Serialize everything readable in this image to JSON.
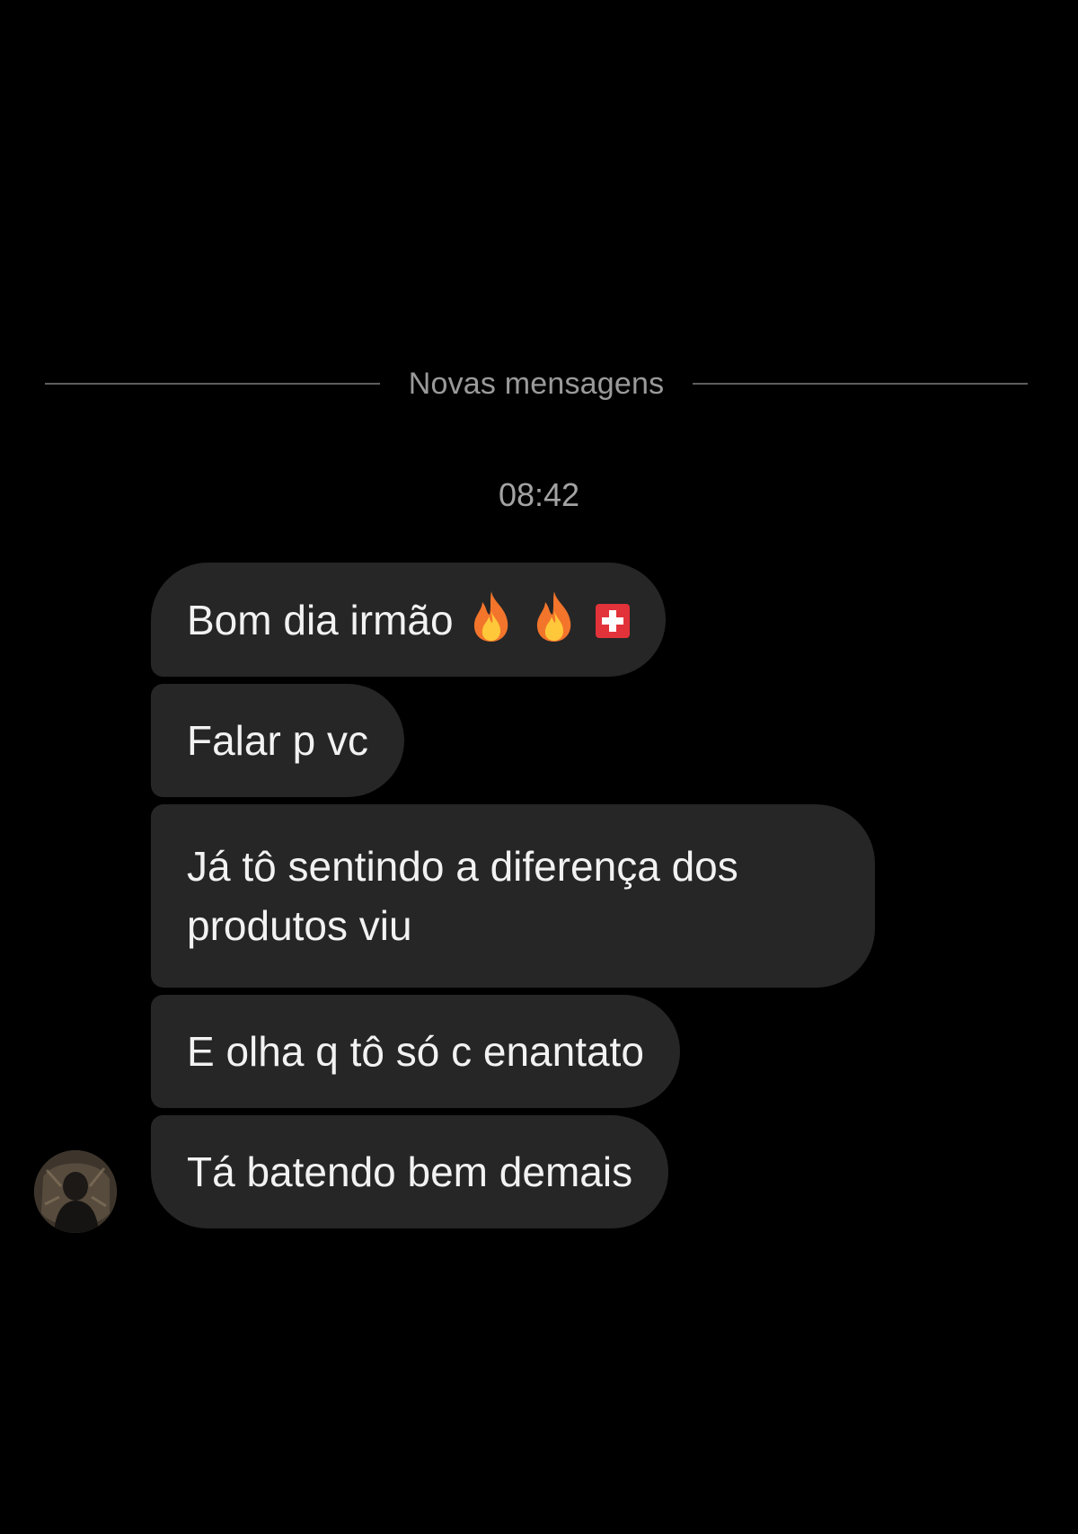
{
  "divider": {
    "label": "Novas mensagens"
  },
  "timestamp": "08:42",
  "messages": [
    {
      "text": "Bom dia irmão",
      "emojis": [
        "fire-icon",
        "fire-icon",
        "swiss-flag-icon"
      ]
    },
    {
      "text": "Falar p vc"
    },
    {
      "text": "Já tô sentindo a diferença dos produtos viu"
    },
    {
      "text": "E olha q tô só c enantato"
    },
    {
      "text": "Tá batendo bem demais"
    }
  ],
  "colors": {
    "background": "#000000",
    "bubble": "#262626",
    "text": "#f2f2f2",
    "muted": "#a3a3a3"
  }
}
